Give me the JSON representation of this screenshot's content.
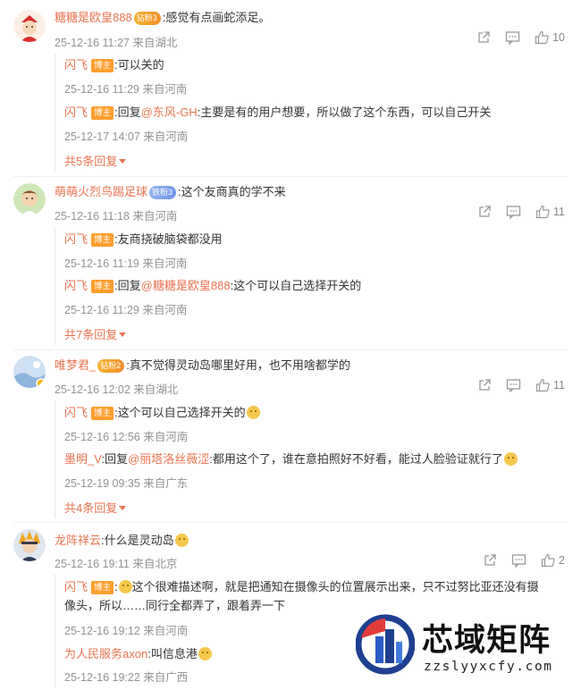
{
  "comments": [
    {
      "user": "糖糖是欧皇888",
      "badge": "钻粉3",
      "text": "感觉有点画蛇添足。",
      "time": "25-12-16 11:27 来自湖北",
      "likes": "10",
      "replies": [
        {
          "user": "闪飞",
          "tag": "博主",
          "text": "可以关的",
          "time": "25-12-16 11:29 来自河南"
        },
        {
          "user": "闪飞",
          "tag": "博主",
          "prefix": "回复",
          "at": "@东风-GH",
          "text": "主要是有的用户想要，所以做了这个东西，可以自己开关",
          "time": "25-12-17 14:07 来自河南"
        }
      ],
      "more": "共5条回复"
    },
    {
      "user": "萌萌火烈鸟踢足球",
      "badge": "铁粉3",
      "text": "这个友商真的学不来",
      "time": "25-12-16 11:18 来自河南",
      "likes": "11",
      "replies": [
        {
          "user": "闪飞",
          "tag": "博主",
          "text": "友商挠破脑袋都没用",
          "time": "25-12-16 11:19 来自河南"
        },
        {
          "user": "闪飞",
          "tag": "博主",
          "prefix": "回复",
          "at": "@糖糖是欧皇888",
          "text": "这个可以自己选择开关的",
          "time": "25-12-16 11:29 来自河南"
        }
      ],
      "more": "共7条回复"
    },
    {
      "user": "唯梦君_",
      "badge": "钻粉2",
      "text": "真不觉得灵动岛哪里好用，也不用啥都学的",
      "time": "25-12-16 12:02 来自湖北",
      "likes": "11",
      "replies": [
        {
          "user": "闪飞",
          "tag": "博主",
          "text": "这个可以自己选择开关的",
          "time": "25-12-16 12:56 来自河南"
        },
        {
          "user": "墨明_V",
          "tag": "",
          "prefix": "回复",
          "at": "@丽塔洛丝薇涩",
          "text": "都用这个了，谁在意拍照好不好看，能过人脸验证就行了",
          "time": "25-12-19 09:35 来自广东"
        }
      ],
      "more": "共4条回复"
    },
    {
      "user": "龙阵祥云",
      "badge": "",
      "text": "什么是灵动岛",
      "time": "25-12-16 19:11 来自北京",
      "likes": "2",
      "replies": [
        {
          "user": "闪飞",
          "tag": "博主",
          "text": "这个很难描述啊，就是把通知在摄像头的位置展示出来，只不过努比亚还没有摄",
          "text2": "像头，所以……同行全都弄了，跟着弄一下",
          "time": "25-12-16 19:12 来自河南"
        },
        {
          "user": "为人民服务axon",
          "tag": "",
          "text": "叫信息港",
          "time": "25-12-16 19:22 来自广西"
        }
      ],
      "more": ""
    }
  ],
  "watermark": {
    "title": "芯域矩阵",
    "url": "zzslyyxcfy.com"
  },
  "icons": {
    "share": "share-icon",
    "comment": "comment-icon",
    "like": "like-icon"
  },
  "colors": {
    "username": "#eb7350",
    "meta": "#939393",
    "blogger_tag": "#ff9e2c"
  }
}
